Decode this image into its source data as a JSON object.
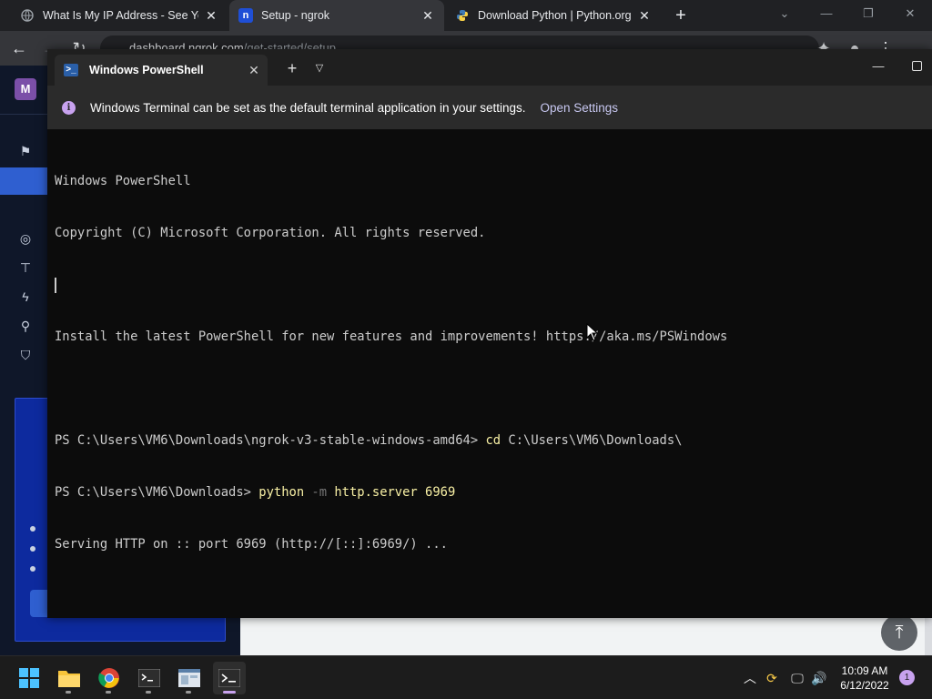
{
  "browser": {
    "tabs": [
      {
        "title": "What Is My IP Address - See Your",
        "favicon": "ip-globe-icon"
      },
      {
        "title": "Setup - ngrok",
        "favicon": "n"
      },
      {
        "title": "Download Python | Python.org",
        "favicon": "python-logo-icon"
      }
    ],
    "new_tab": "+",
    "url_host": "dashboard.ngrok.com",
    "url_path": "/get-started/setup"
  },
  "ngrok": {
    "avatar_letter": "M"
  },
  "terminal": {
    "tab_title": "Windows PowerShell",
    "infobar": {
      "message": "Windows Terminal can be set as the default terminal application in your settings.",
      "link": "Open Settings"
    },
    "lines": {
      "l1": "Windows PowerShell",
      "l2": "Copyright (C) Microsoft Corporation. All rights reserved.",
      "l3": "",
      "l4": "Install the latest PowerShell for new features and improvements! https://aka.ms/PSWindows",
      "l5": "",
      "l6_prompt": "PS C:\\Users\\VM6\\Downloads\\ngrok-v3-stable-windows-amd64> ",
      "l6_cmd": "cd",
      "l6_arg": " C:\\Users\\VM6\\Downloads\\",
      "l7_prompt": "PS C:\\Users\\VM6\\Downloads> ",
      "l7_cmd": "python",
      "l7_flag": " -m",
      "l7_arg": " http.server 6969",
      "l8": "Serving HTTP on :: port 6969 (http://[::]:6969/) ..."
    }
  },
  "taskbar": {
    "time": "10:09 AM",
    "date": "6/12/2022",
    "notification_count": "1"
  },
  "colors": {
    "terminal_bg": "#0c0c0c",
    "terminal_fg": "#cccccc",
    "command_yellow": "#f9f1a5",
    "accent_purple": "#c8a2ef",
    "ngrok_active_blue": "#2f5fd0"
  }
}
